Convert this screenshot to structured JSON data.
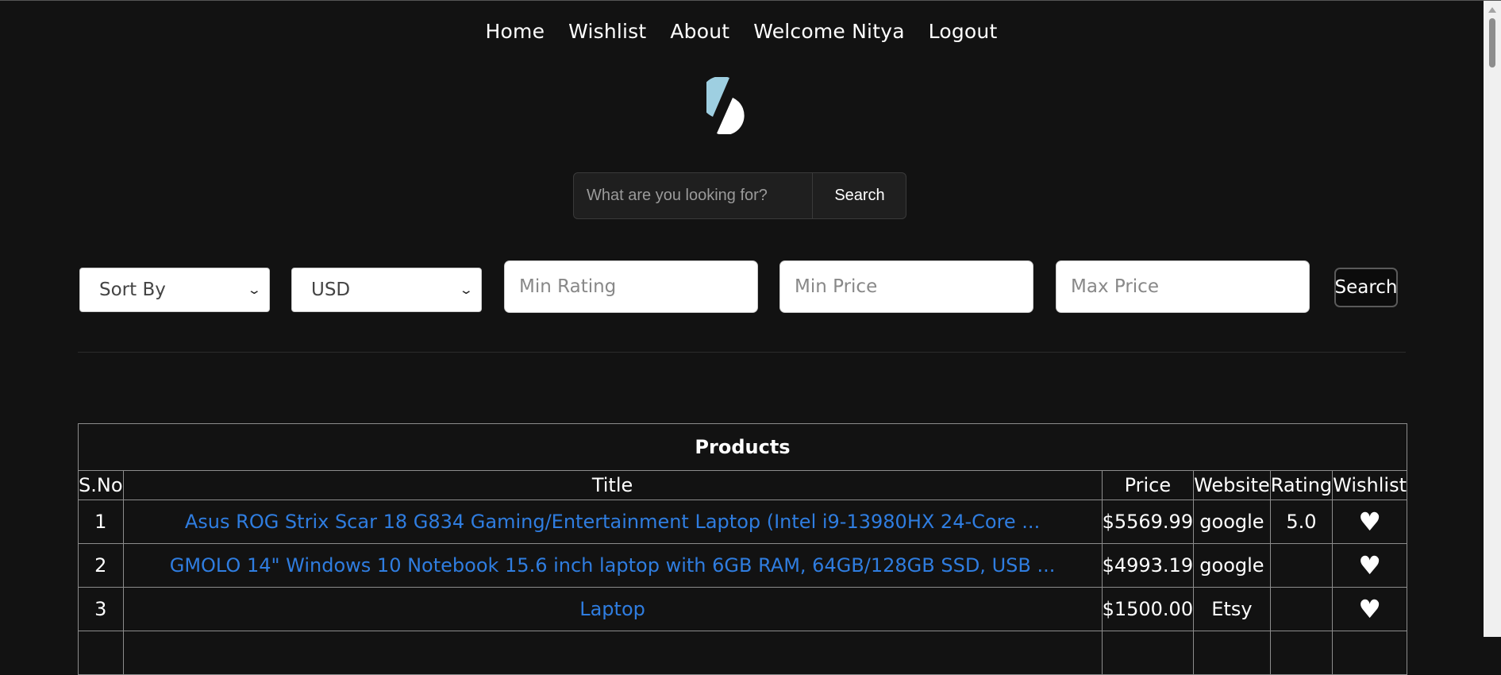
{
  "nav": {
    "home": "Home",
    "wishlist": "Wishlist",
    "about": "About",
    "welcome": "Welcome Nitya",
    "logout": "Logout"
  },
  "logo": {
    "icon": "split-circle-logo",
    "colors": {
      "top": "#9ecfe1",
      "bottom": "#ffffff"
    }
  },
  "search": {
    "placeholder": "What are you looking for?",
    "button": "Search"
  },
  "filters": {
    "sort_by": "Sort By",
    "currency": "USD",
    "min_rating_placeholder": "Min Rating",
    "min_price_placeholder": "Min Price",
    "max_price_placeholder": "Max Price",
    "button": "Search"
  },
  "table": {
    "caption": "Products",
    "columns": [
      "S.No",
      "Title",
      "Price",
      "Website",
      "Rating",
      "Wishlist"
    ],
    "rows": [
      {
        "sno": "1",
        "title": "Asus ROG Strix Scar 18 G834 Gaming/Entertainment Laptop (Intel i9-13980HX 24-Core ...",
        "price": "$5569.99",
        "website": "google",
        "rating": "5.0",
        "wishlist": "♥"
      },
      {
        "sno": "2",
        "title": "GMOLO 14\" Windows 10 Notebook 15.6 inch laptop with 6GB RAM, 64GB/128GB SSD, USB ...",
        "price": "$4993.19",
        "website": "google",
        "rating": "",
        "wishlist": "♥"
      },
      {
        "sno": "3",
        "title": "Laptop",
        "price": "$1500.00",
        "website": "Etsy",
        "rating": "",
        "wishlist": "♥"
      }
    ]
  },
  "colors": {
    "background": "#121212",
    "link": "#2f7de0"
  }
}
